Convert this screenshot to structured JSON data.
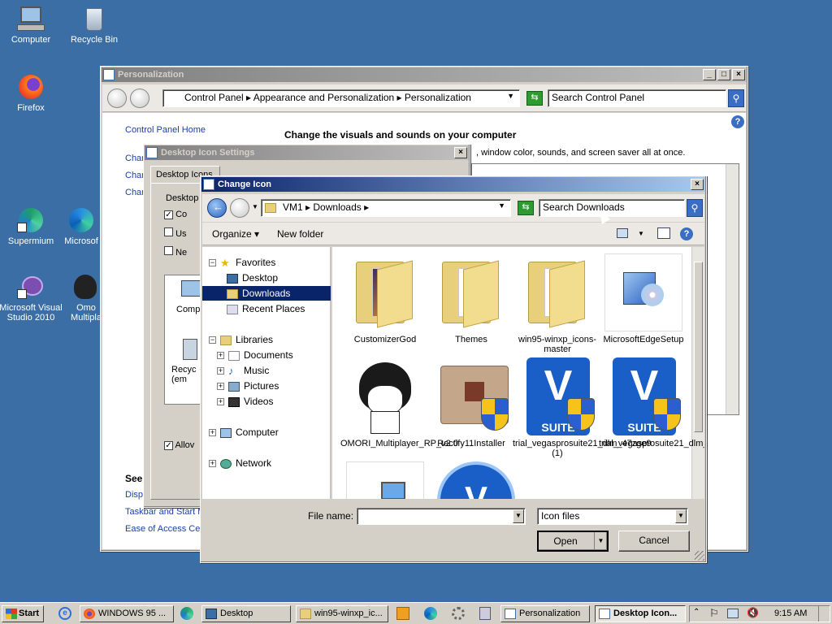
{
  "desktop": {
    "icons": [
      {
        "label": "Computer"
      },
      {
        "label": "Recycle Bin"
      },
      {
        "label": "Firefox"
      },
      {
        "label": "Supermium"
      },
      {
        "label": "Microsof"
      },
      {
        "label": "Microsoft Visual Studio 2010"
      },
      {
        "label": "Omo Multipla"
      }
    ]
  },
  "personalization": {
    "title": "Personalization",
    "breadcrumb": [
      "Control Panel",
      "Appearance and Personalization",
      "Personalization"
    ],
    "search_placeholder": "Search Control Panel",
    "control_panel_home": "Control Panel Home",
    "heading": "Change the visuals and sounds on your computer",
    "subtext": ", window color, sounds, and screen saver all at once.",
    "left_links": [
      "Char",
      "Char",
      "Char"
    ],
    "see_also": "See",
    "see_links": [
      "Displ",
      "Taskbar and Start M",
      "Ease of Access Cen"
    ]
  },
  "desktop_icon_settings": {
    "title": "Desktop Icon Settings",
    "tab": "Desktop Icons",
    "group": "Desktop",
    "checkboxes": [
      "Co",
      "Us",
      "Ne"
    ],
    "icon_items": [
      "Comp",
      "Recyc (em"
    ],
    "allow": "Allov"
  },
  "change_icon": {
    "title": "Change Icon",
    "path": [
      "VM1",
      "Downloads"
    ],
    "search_placeholder": "Search Downloads",
    "toolbar": {
      "organize": "Organize",
      "new_folder": "New folder"
    },
    "tree": {
      "favorites": "Favorites",
      "desktop": "Desktop",
      "downloads": "Downloads",
      "recent": "Recent Places",
      "libraries": "Libraries",
      "documents": "Documents",
      "music": "Music",
      "pictures": "Pictures",
      "videos": "Videos",
      "computer": "Computer",
      "network": "Network"
    },
    "files": [
      {
        "name": "CustomizerGod"
      },
      {
        "name": "Themes"
      },
      {
        "name": "win95-winxp_icons-master"
      },
      {
        "name": "MicrosoftEdgeSetup"
      },
      {
        "name": "OMORI_Multiplayer_RP_v2.0"
      },
      {
        "name": "Rectify11Installer"
      },
      {
        "name": "trial_vegasprosuite21_dlm_47zge9 (1)"
      },
      {
        "name": "trial_vegasprosuite21_dlm_47zge9"
      }
    ],
    "vegas_text": "V",
    "vegas_suite": "SUITE",
    "filename_label": "File name:",
    "filename_value": "",
    "filetype": "Icon files",
    "open_label": "Open",
    "cancel_label": "Cancel"
  },
  "taskbar": {
    "start": "Start",
    "buttons": [
      {
        "label": "WINDOWS 95 ..."
      },
      {
        "label": "Desktop"
      },
      {
        "label": "win95-winxp_ic..."
      },
      {
        "label": "Personalization"
      },
      {
        "label": "Desktop Icon..."
      }
    ],
    "clock": "9:15 AM"
  }
}
